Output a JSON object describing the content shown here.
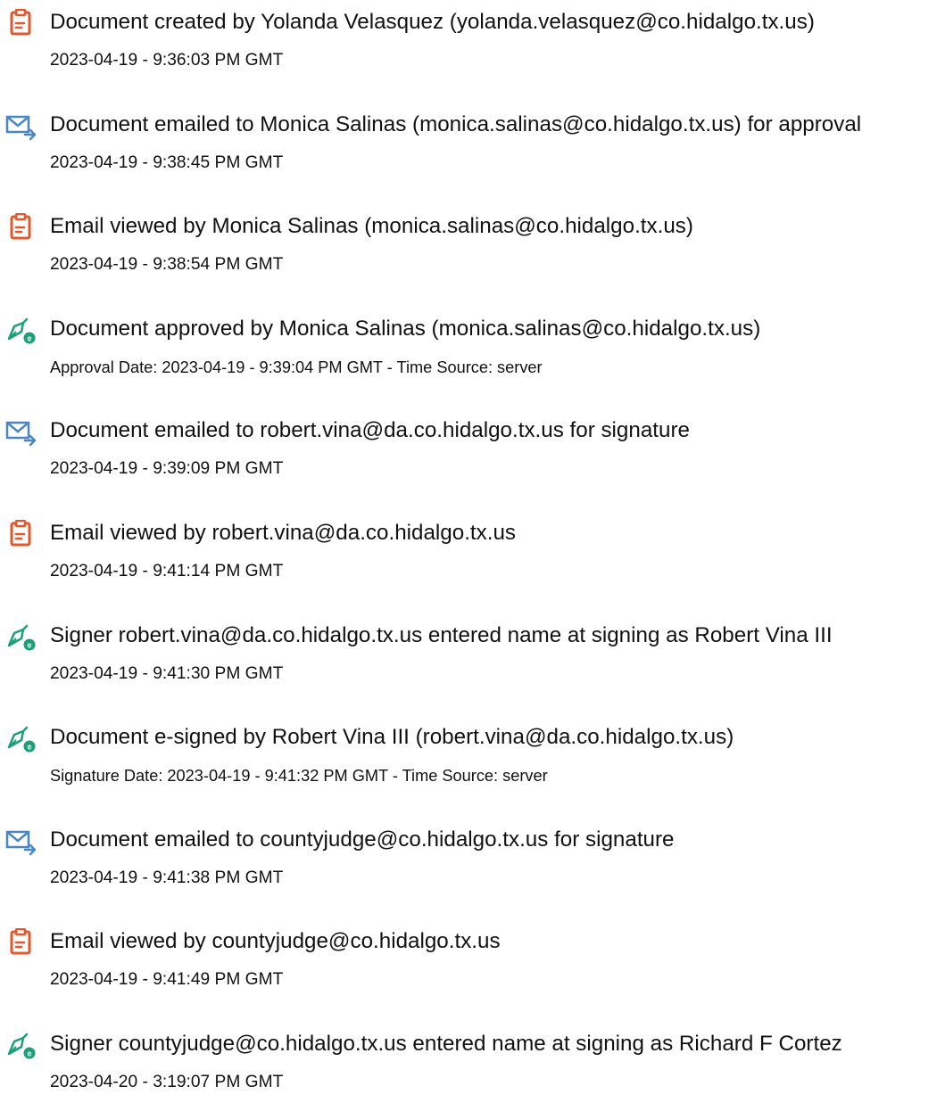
{
  "events": [
    {
      "icon": "document-created-icon",
      "title": "Document created by Yolanda Velasquez (yolanda.velasquez@co.hidalgo.tx.us)",
      "detail": "2023-04-19 - 9:36:03 PM GMT"
    },
    {
      "icon": "email-sent-icon",
      "title": "Document emailed to Monica Salinas (monica.salinas@co.hidalgo.tx.us) for approval",
      "detail": "2023-04-19 - 9:38:45 PM GMT"
    },
    {
      "icon": "email-viewed-icon",
      "title": "Email viewed by Monica Salinas (monica.salinas@co.hidalgo.tx.us)",
      "detail": "2023-04-19 - 9:38:54 PM GMT"
    },
    {
      "icon": "pen-signed-icon",
      "title": "Document approved by Monica Salinas (monica.salinas@co.hidalgo.tx.us)",
      "detail": "Approval Date: 2023-04-19 - 9:39:04 PM GMT - Time Source: server"
    },
    {
      "icon": "email-sent-icon",
      "title": "Document emailed to robert.vina@da.co.hidalgo.tx.us for signature",
      "detail": "2023-04-19 - 9:39:09 PM GMT"
    },
    {
      "icon": "email-viewed-icon",
      "title": "Email viewed by robert.vina@da.co.hidalgo.tx.us",
      "detail": "2023-04-19 - 9:41:14 PM GMT"
    },
    {
      "icon": "pen-signed-icon",
      "title": "Signer robert.vina@da.co.hidalgo.tx.us entered name at signing as Robert Vina III",
      "detail": "2023-04-19 - 9:41:30 PM GMT"
    },
    {
      "icon": "pen-signed-icon",
      "title": "Document e-signed by Robert Vina III (robert.vina@da.co.hidalgo.tx.us)",
      "detail": "Signature Date: 2023-04-19 - 9:41:32 PM GMT - Time Source: server"
    },
    {
      "icon": "email-sent-icon",
      "title": "Document emailed to countyjudge@co.hidalgo.tx.us for signature",
      "detail": "2023-04-19 - 9:41:38 PM GMT"
    },
    {
      "icon": "email-viewed-icon",
      "title": "Email viewed by countyjudge@co.hidalgo.tx.us",
      "detail": "2023-04-19 - 9:41:49 PM GMT"
    },
    {
      "icon": "pen-signed-icon",
      "title": "Signer countyjudge@co.hidalgo.tx.us entered name at signing as Richard F Cortez",
      "detail": "2023-04-20 - 3:19:07 PM GMT"
    }
  ],
  "colors": {
    "document_icon": "#e2572b",
    "email_icon": "#4a86c5",
    "sign_icon": "#1f9e7a",
    "text": "#111111"
  }
}
